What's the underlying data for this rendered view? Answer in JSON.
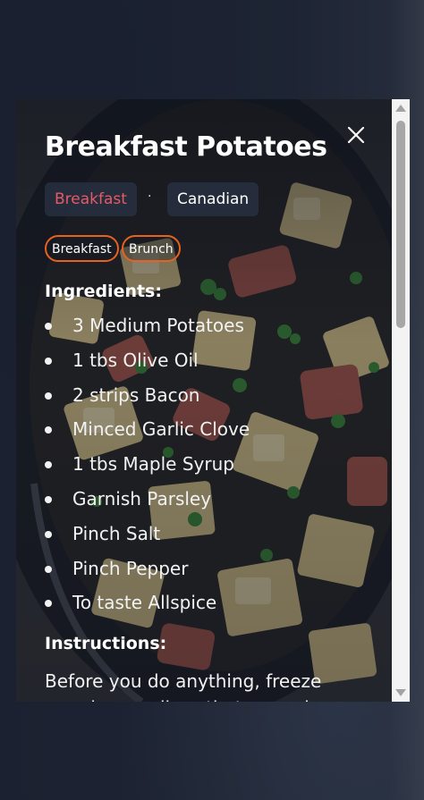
{
  "recipe": {
    "title": "Breakfast Potatoes",
    "category": "Breakfast",
    "area": "Canadian",
    "separator": "·",
    "tags": [
      "Breakfast",
      "Brunch"
    ],
    "ingredients_heading": "Ingredients:",
    "ingredients": [
      "3 Medium Potatoes",
      "1 tbs Olive Oil",
      "2 strips Bacon",
      "Minced Garlic Clove",
      "1 tbs Maple Syrup",
      "Garnish Parsley",
      "Pinch Salt",
      "Pinch Pepper",
      "To taste Allspice"
    ],
    "instructions_heading": "Instructions:",
    "instructions_text": "Before you do anything, freeze your bacon slices that way when you're"
  },
  "icons": {
    "close": "close-icon",
    "scroll_up": "scroll-up-arrow-icon",
    "scroll_down": "scroll-down-arrow-icon"
  },
  "colors": {
    "category_text": "#e65a66",
    "tag_border": "#e8611f",
    "chip_bg": "#262e3e",
    "backdrop": "#1d2433"
  }
}
